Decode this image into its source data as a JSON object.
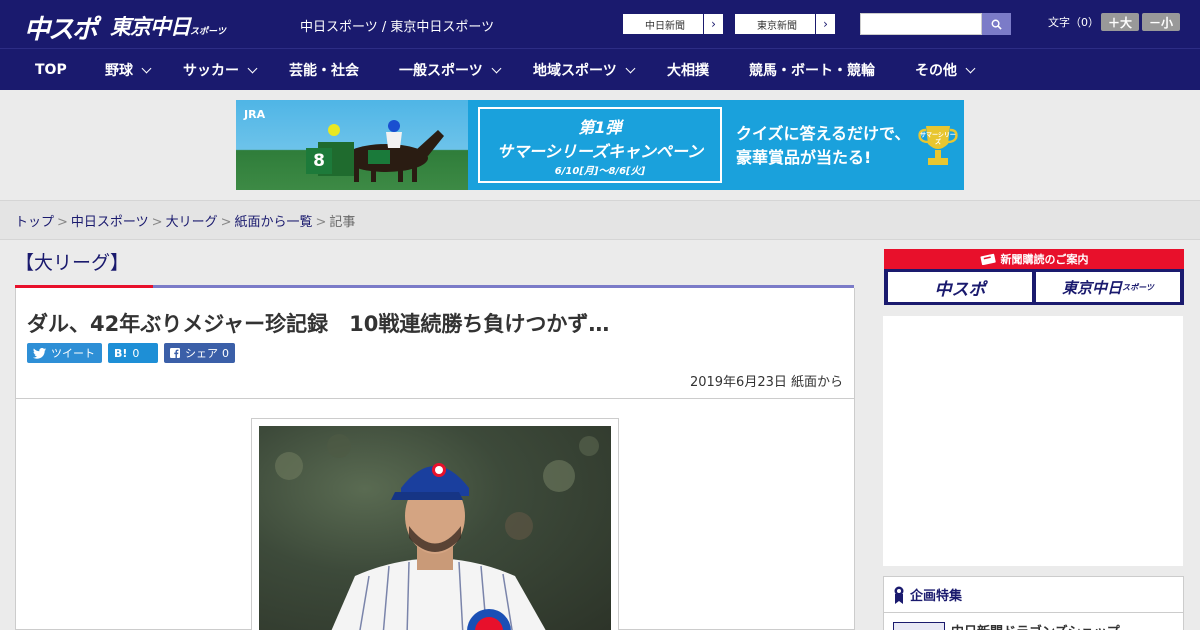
{
  "header": {
    "logo_chuspo": "中スポ",
    "logo_tokyo": "東京中日",
    "logo_tokyo_suffix": "スポーツ",
    "site_names": "中日スポーツ / 東京中日スポーツ",
    "newspaper_links": [
      {
        "label": "中日新聞",
        "arrow": "›"
      },
      {
        "label": "東京新聞",
        "arrow": "›"
      }
    ],
    "search": {
      "placeholder": "",
      "icon": "search-icon"
    },
    "font_size": {
      "label": "文字（0）",
      "increase": "＋大",
      "decrease": "－小"
    }
  },
  "nav": {
    "items": [
      {
        "label": "TOP",
        "has_dropdown": false
      },
      {
        "label": "野球",
        "has_dropdown": true
      },
      {
        "label": "サッカー",
        "has_dropdown": true
      },
      {
        "label": "芸能・社会",
        "has_dropdown": false
      },
      {
        "label": "一般スポーツ",
        "has_dropdown": true
      },
      {
        "label": "地域スポーツ",
        "has_dropdown": true
      },
      {
        "label": "大相撲",
        "has_dropdown": false
      },
      {
        "label": "競馬・ボート・競輪",
        "has_dropdown": false
      },
      {
        "label": "その他",
        "has_dropdown": true
      }
    ]
  },
  "banner": {
    "brand": "JRA",
    "saddle_number": "8",
    "campaign_prefix": "第1弾",
    "campaign_title": "サマーシリーズキャンペーン",
    "campaign_dates": "6/10[月]～8/6[火]",
    "promo_line1": "クイズに答えるだけで、",
    "promo_line2": "豪華賞品が当たる!",
    "trophy_label": "サマーシリーズ"
  },
  "breadcrumb": {
    "items": [
      "トップ",
      "中日スポーツ",
      "大リーグ",
      "紙面から一覧"
    ],
    "current": "記事",
    "separator": ">"
  },
  "article": {
    "category": "【大リーグ】",
    "title": "ダル、42年ぶりメジャー珍記録　10戦連続勝ち負けつかず…",
    "social": {
      "tweet": "ツイート",
      "hatena": "B!",
      "hatena_count": "0",
      "facebook": "シェア",
      "facebook_count": "0"
    },
    "date": "2019年6月23日 紙面から"
  },
  "sidebar": {
    "subscribe_heading": "新聞購読のご案内",
    "subscribe_chuspo": "中スポ",
    "subscribe_tokyo": "東京中日",
    "subscribe_tokyo_suffix": "スポーツ",
    "feature_heading": "企画特集",
    "feature_item": "中日新聞ドラゴンズショップ"
  },
  "colors": {
    "brand_navy": "#1a1a6e",
    "accent_red": "#e8102b",
    "accent_purple": "#7b7bc8",
    "banner_blue": "#1aa1dc"
  }
}
